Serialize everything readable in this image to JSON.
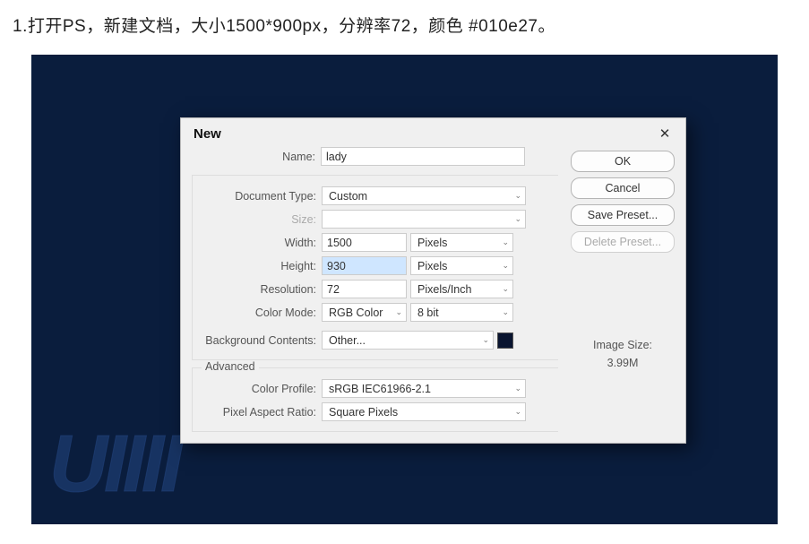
{
  "instruction": "1.打开PS，新建文档，大小1500*900px，分辨率72，颜色 #010e27。",
  "watermark": "UIIII",
  "dialog": {
    "title": "New",
    "buttons": {
      "ok": "OK",
      "cancel": "Cancel",
      "save_preset": "Save Preset...",
      "delete_preset": "Delete Preset..."
    },
    "image_size": {
      "label": "Image Size:",
      "value": "3.99M"
    },
    "labels": {
      "name": "Name:",
      "document_type": "Document Type:",
      "size": "Size:",
      "width": "Width:",
      "height": "Height:",
      "resolution": "Resolution:",
      "color_mode": "Color Mode:",
      "background_contents": "Background Contents:",
      "advanced": "Advanced",
      "color_profile": "Color Profile:",
      "pixel_aspect_ratio": "Pixel Aspect Ratio:"
    },
    "values": {
      "name": "lady",
      "document_type": "Custom",
      "size": "",
      "width": "1500",
      "width_unit": "Pixels",
      "height": "930",
      "height_unit": "Pixels",
      "resolution": "72",
      "resolution_unit": "Pixels/Inch",
      "color_mode": "RGB Color",
      "color_depth": "8 bit",
      "background_contents": "Other...",
      "bg_swatch": "#0a1530",
      "color_profile": "sRGB IEC61966-2.1",
      "pixel_aspect_ratio": "Square Pixels"
    }
  }
}
